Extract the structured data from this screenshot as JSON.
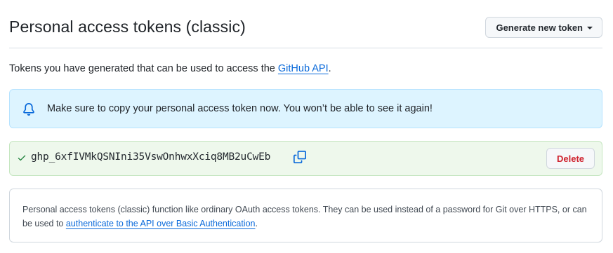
{
  "header": {
    "title": "Personal access tokens (classic)",
    "generate_button_label": "Generate new token"
  },
  "intro": {
    "text": "Tokens you have generated that can be used to access the ",
    "link_text": "GitHub API",
    "suffix": "."
  },
  "flash": {
    "icon": "bell-icon",
    "message": "Make sure to copy your personal access token now. You won’t be able to see it again!"
  },
  "token": {
    "value": "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",
    "delete_label": "Delete",
    "status_icon": "check-icon",
    "copy_icon": "copy-icon"
  },
  "note": {
    "text": "Personal access tokens (classic) function like ordinary OAuth access tokens. They can be used instead of a password for Git over HTTPS, or can be used to ",
    "link_text": "authenticate to the API over Basic Authentication",
    "suffix": "."
  },
  "colors": {
    "accent_link": "#0969da",
    "flash_bg": "#ddf4ff",
    "success_bg": "#eef8ec",
    "success_icon": "#1a7f37",
    "danger_text": "#cf222e"
  }
}
